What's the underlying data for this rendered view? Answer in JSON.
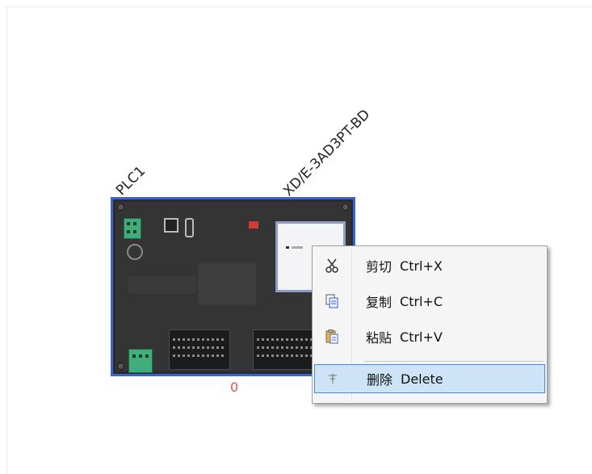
{
  "device": {
    "name_label": "PLC1",
    "module_label": "XD/E-3AD3PT-BD",
    "index_label": "0"
  },
  "context_menu": {
    "items": [
      {
        "icon": "scissors-icon",
        "label": "剪切",
        "shortcut": "Ctrl+X"
      },
      {
        "icon": "copy-icon",
        "label": "复制",
        "shortcut": "Ctrl+C"
      },
      {
        "icon": "paste-icon",
        "label": "粘贴",
        "shortcut": "Ctrl+V"
      },
      {
        "icon": "delete-icon",
        "label": "删除",
        "shortcut": "Delete"
      }
    ],
    "highlighted_item": "删除"
  },
  "colors": {
    "selection_border": "#3d62d3",
    "index_text": "#d9534f",
    "menu_hover_bg": "#cde4f7",
    "menu_hover_border": "#3d8ee0"
  }
}
